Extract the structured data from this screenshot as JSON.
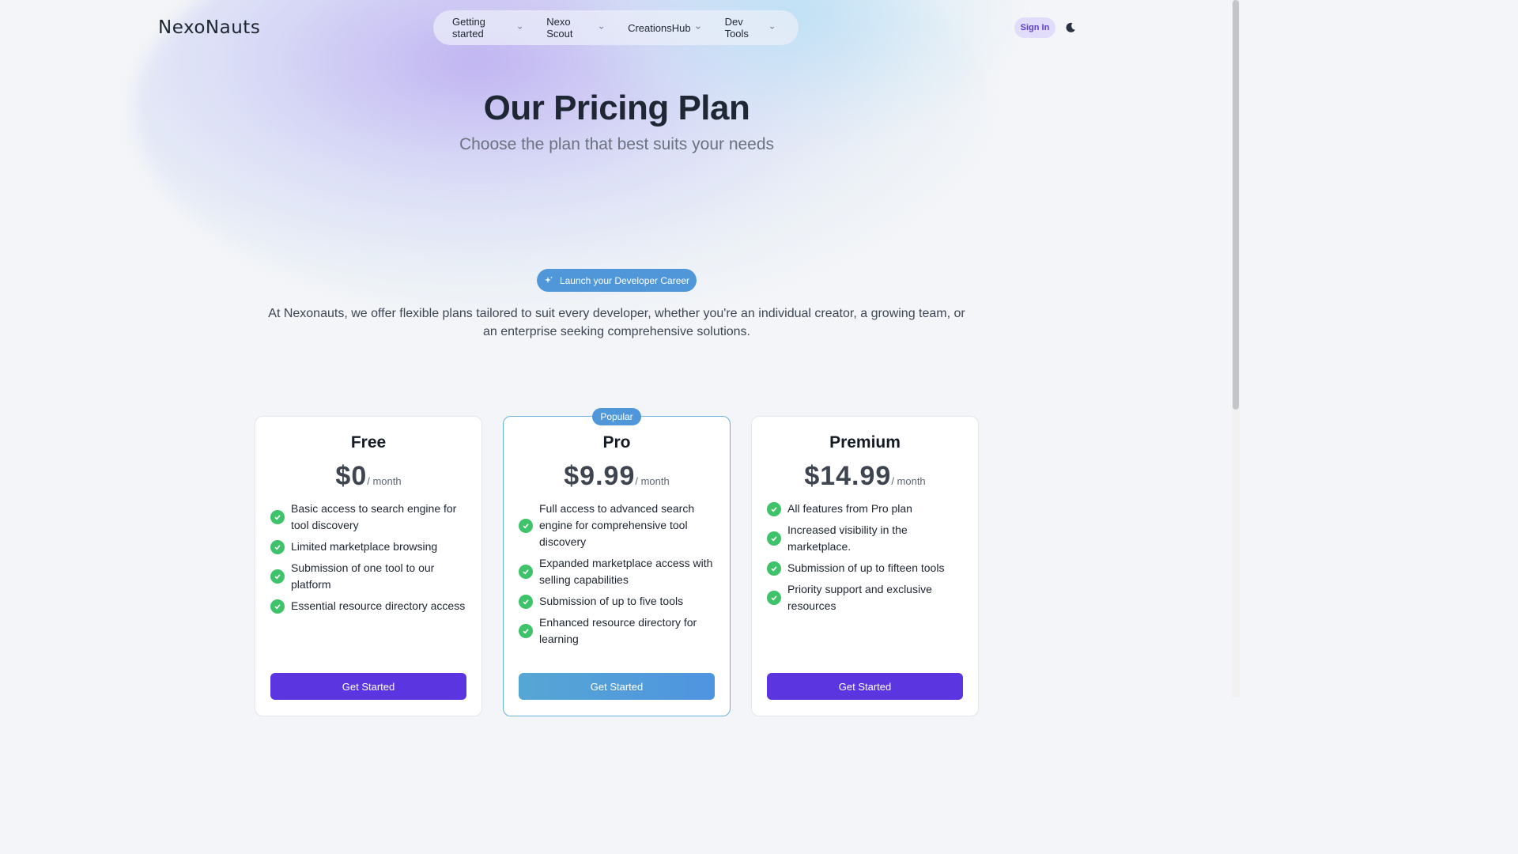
{
  "header": {
    "logo": "NexoNauts",
    "nav": [
      {
        "label": "Getting started"
      },
      {
        "label": "Nexo Scout"
      },
      {
        "label": "CreationsHub"
      },
      {
        "label": "Dev Tools"
      }
    ],
    "signin_label": "Sign In",
    "theme_icon": "moon-icon"
  },
  "hero": {
    "title": "Our Pricing Plan",
    "subtitle": "Choose the plan that best suits your needs"
  },
  "badge": {
    "label": "Launch your Developer Career",
    "icon": "sparkle-icon"
  },
  "intro": "At Nexonauts, we offer flexible plans tailored to suit every developer, whether you're an individual creator, a growing team, or an enterprise seeking comprehensive solutions.",
  "plans": [
    {
      "name": "Free",
      "price": "$0",
      "period": "/ month",
      "features": [
        "Basic access to search engine for tool discovery",
        "Limited marketplace browsing",
        "Submission of one tool to our platform",
        "Essential resource directory access"
      ],
      "cta": "Get Started"
    },
    {
      "name": "Pro",
      "tag": "Popular",
      "price": "$9.99",
      "period": "/ month",
      "features": [
        "Full access to advanced search engine for comprehensive tool discovery",
        "Expanded marketplace access with selling capabilities",
        "Submission of up to five tools",
        "Enhanced resource directory for learning"
      ],
      "cta": "Get Started"
    },
    {
      "name": "Premium",
      "price": "$14.99",
      "period": "/ month",
      "features": [
        "All features from Pro plan",
        "Increased visibility in the marketplace.",
        "Submission of up to fifteen tools",
        "Priority support and exclusive resources"
      ],
      "cta": "Get Started"
    }
  ],
  "colors": {
    "accent": "#5b35e0",
    "badge": "#4f97d8",
    "check": "#3ec26a"
  }
}
